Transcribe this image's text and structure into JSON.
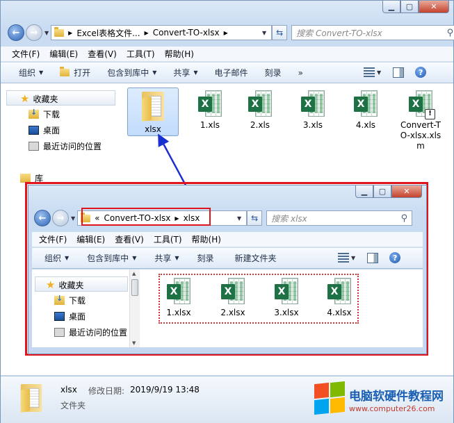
{
  "outer": {
    "address": {
      "crumbs": [
        "Excel表格文件...",
        "Convert-TO-xlsx"
      ]
    },
    "search_placeholder": "搜索 Convert-TO-xlsx",
    "menu": [
      "文件(F)",
      "编辑(E)",
      "查看(V)",
      "工具(T)",
      "帮助(H)"
    ],
    "toolbar": {
      "organize": "组织",
      "open": "打开",
      "include": "包含到库中",
      "share": "共享",
      "email": "电子邮件",
      "burn": "刻录",
      "more": "»"
    },
    "nav": {
      "favorites": "收藏夹",
      "downloads": "下载",
      "desktop": "桌面",
      "recent": "最近访问的位置",
      "libraries": "库"
    },
    "files": [
      {
        "name": "xlsx",
        "kind": "folder"
      },
      {
        "name": "1.xls",
        "kind": "excel"
      },
      {
        "name": "2.xls",
        "kind": "excel"
      },
      {
        "name": "3.xls",
        "kind": "excel"
      },
      {
        "name": "4.xls",
        "kind": "excel"
      },
      {
        "name": "Convert-TO-xlsx.xlsm",
        "kind": "excel-macro"
      }
    ],
    "status": {
      "name": "xlsx",
      "modified_label": "修改日期:",
      "modified": "2019/9/19 13:48",
      "type": "文件夹"
    }
  },
  "inner": {
    "address": {
      "prefix": "«",
      "crumbs": [
        "Convert-TO-xlsx",
        "xlsx"
      ]
    },
    "search_placeholder": "搜索 xlsx",
    "menu": [
      "文件(F)",
      "编辑(E)",
      "查看(V)",
      "工具(T)",
      "帮助(H)"
    ],
    "toolbar": {
      "organize": "组织",
      "include": "包含到库中",
      "share": "共享",
      "burn": "刻录",
      "new_folder": "新建文件夹"
    },
    "nav": {
      "favorites": "收藏夹",
      "downloads": "下载",
      "desktop": "桌面",
      "recent": "最近访问的位置"
    },
    "files": [
      {
        "name": "1.xlsx"
      },
      {
        "name": "2.xlsx"
      },
      {
        "name": "3.xlsx"
      },
      {
        "name": "4.xlsx"
      }
    ]
  },
  "watermark": {
    "title": "电脑软硬件教程网",
    "url": "www.computer26.com"
  },
  "colors": {
    "highlight": "#e0141c",
    "arrow": "#1a2fd0",
    "excel": "#1e7145"
  }
}
